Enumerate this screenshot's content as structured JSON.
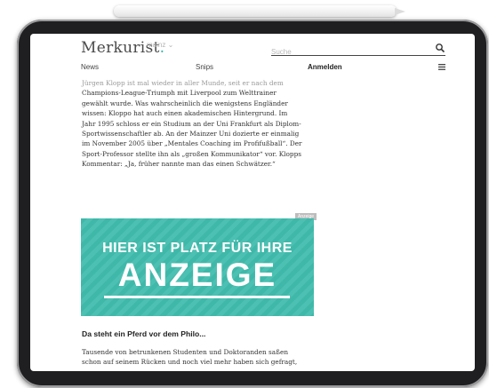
{
  "site": {
    "logo": "Merkurist",
    "logo_dot": ".",
    "region": "mainz",
    "region_caret": "⌄"
  },
  "search": {
    "placeholder": "Suche"
  },
  "nav": {
    "news": "News",
    "snips": "Snips",
    "login": "Anmelden"
  },
  "article": {
    "lines": [
      "Jürgen Klopp ist mal wieder in aller Munde, seit er nach dem",
      "Champions-League-Triumph mit Liverpool zum Welttrainer",
      "gewählt wurde. Was wahrscheinlich die wenigstens Engländer",
      "wissen: Kloppo hat auch einen akademischen Hintergrund. Im",
      "Jahr 1995 schloss er ein Studium an der Uni Frankfurt als Diplom-",
      "Sportwissenschaftler ab. An der Mainzer Uni dozierte er einmalig",
      "im November 2005 über „Mentales Coaching im Profifußball“. Der",
      "Sport-Professor stellte ihn als „großen Kommunikator“ vor. Klopps",
      "Kommentar: „Ja, früher nannte man das einen Schwätzer.“"
    ]
  },
  "ad": {
    "label": "Anzeige",
    "line1": "HIER IST PLATZ FÜR IHRE",
    "line2": "ANZEIGE",
    "color": "#3fb8a9"
  },
  "teaser": {
    "title": "Da steht ein Pferd vor dem Philo...",
    "line1": "Tausende von betrunkenen Studenten und Doktoranden saßen",
    "line2": "schon auf seinem Rücken und noch viel mehr haben sich gefragt,"
  },
  "icons": {
    "search": "search-icon",
    "menu": "hamburger-menu-icon"
  },
  "colors": {
    "accent": "#2fb7a8",
    "device": "#1f1f21"
  }
}
